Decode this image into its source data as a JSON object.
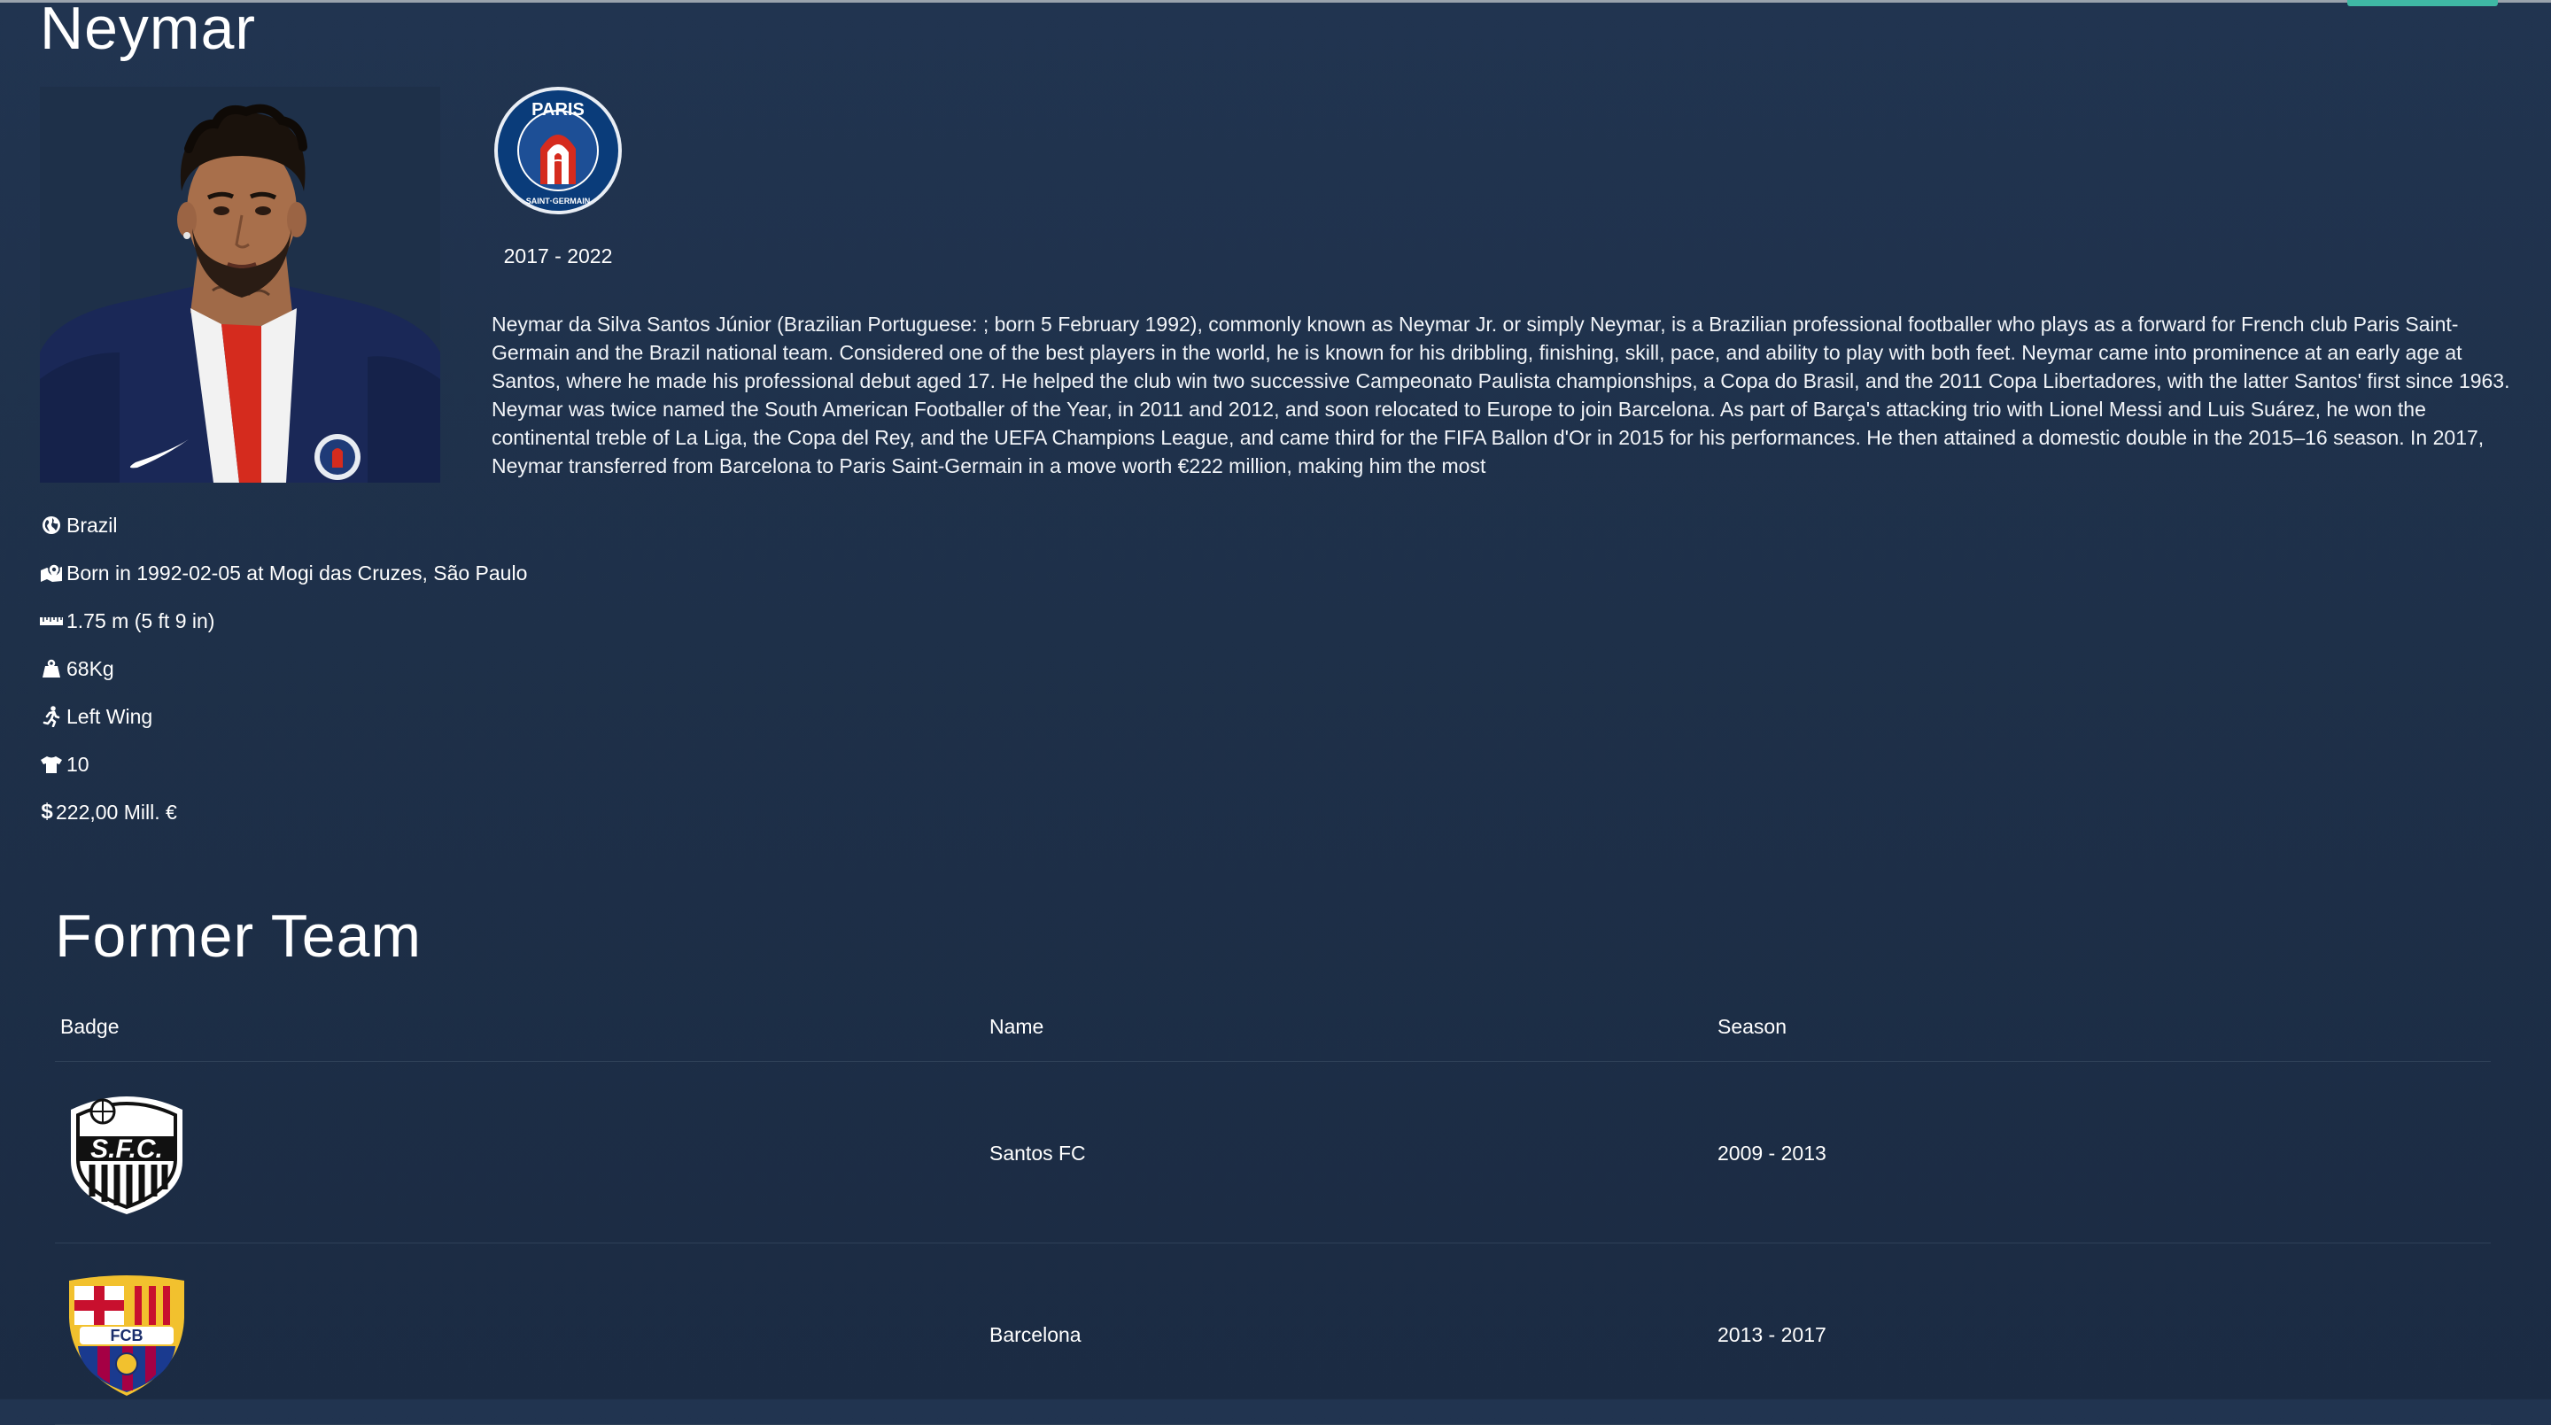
{
  "player": {
    "name": "Neymar",
    "current_team": {
      "season": "2017 - 2022",
      "badge_icon": "psg-badge-icon"
    },
    "description": "Neymar da Silva Santos Júnior (Brazilian Portuguese: ; born 5 February 1992), commonly known as Neymar Jr. or simply Neymar, is a Brazilian professional footballer who plays as a forward for French club Paris Saint-Germain and the Brazil national team. Considered one of the best players in the world, he is known for his dribbling, finishing, skill, pace, and ability to play with both feet. Neymar came into prominence at an early age at Santos, where he made his professional debut aged 17. He helped the club win two successive Campeonato Paulista championships, a Copa do Brasil, and the 2011 Copa Libertadores, with the latter Santos' first since 1963. Neymar was twice named the South American Footballer of the Year, in 2011 and 2012, and soon relocated to Europe to join Barcelona. As part of Barça's attacking trio with Lionel Messi and Luis Suárez, he won the continental treble of La Liga, the Copa del Rey, and the UEFA Champions League, and came third for the FIFA Ballon d'Or in 2015 for his performances. He then attained a domestic double in the 2015–16 season. In 2017, Neymar transferred from Barcelona to Paris Saint-Germain in a move worth €222 million, making him the most",
    "info": {
      "nationality": "Brazil",
      "birth": "Born in 1992-02-05 at Mogi das Cruzes, São Paulo",
      "height": "1.75 m (5 ft 9 in)",
      "weight": "68Kg",
      "position": "Left Wing",
      "number": "10",
      "currency_symbol": "$",
      "value": "222,00 Mill. €"
    }
  },
  "former_team": {
    "title": "Former Team",
    "columns": [
      "Badge",
      "Name",
      "Season"
    ],
    "rows": [
      {
        "name": "Santos FC",
        "season": "2009 - 2013",
        "badge_icon": "santos-badge-icon"
      },
      {
        "name": "Barcelona",
        "season": "2013 - 2017",
        "badge_icon": "barcelona-badge-icon"
      }
    ]
  },
  "colors": {
    "background": "#1f3049",
    "accent": "#3fb8a4",
    "psg_blue": "#004170",
    "psg_red": "#da291c"
  }
}
